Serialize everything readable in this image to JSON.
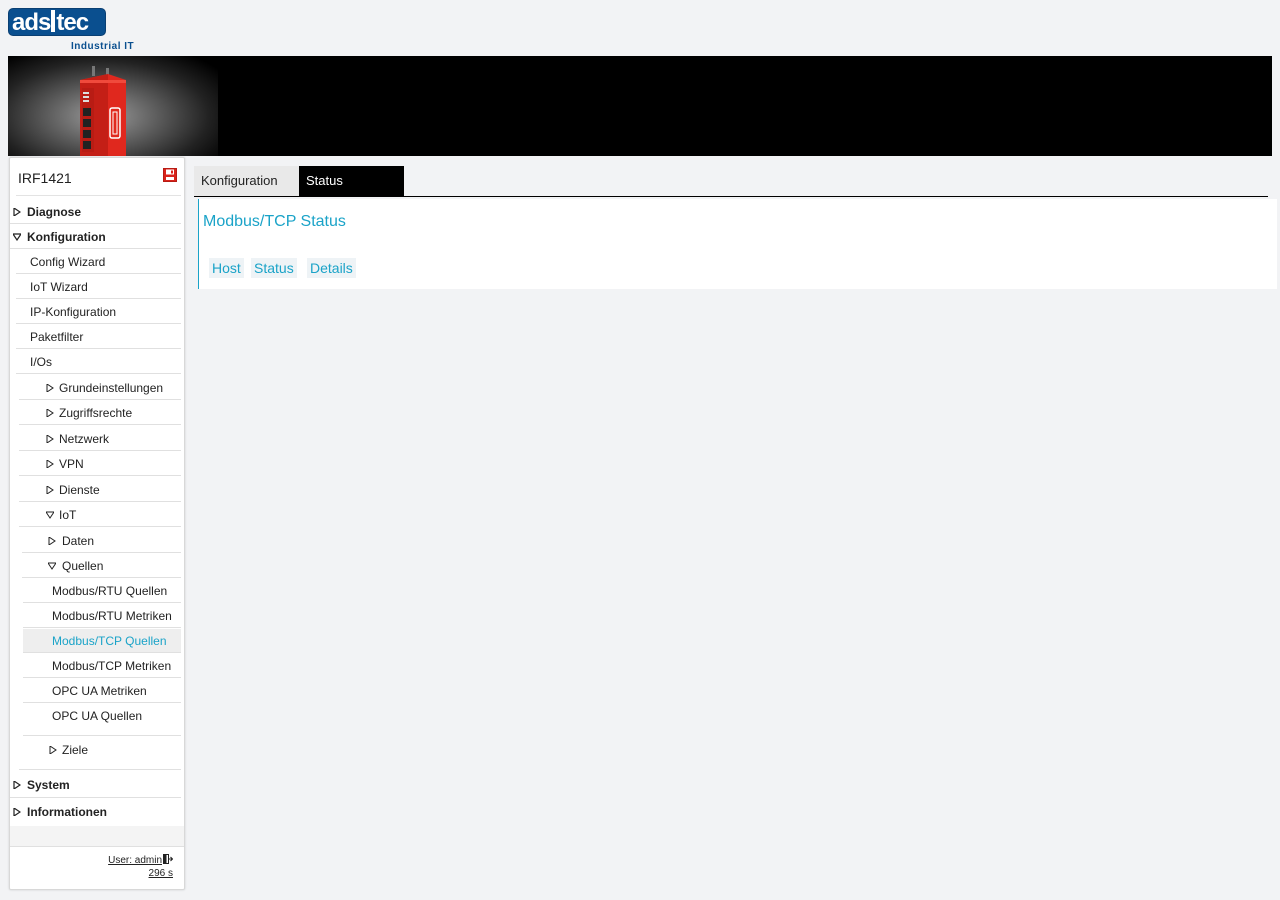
{
  "brand": {
    "logo_left": "ads",
    "logo_right": "tec",
    "subtitle": "Industrial IT"
  },
  "sidebar": {
    "device_name": "IRF1421",
    "items": [
      {
        "label": "Diagnose"
      },
      {
        "label": "Konfiguration"
      },
      {
        "label": "Config Wizard"
      },
      {
        "label": "IoT Wizard"
      },
      {
        "label": "IP-Konfiguration"
      },
      {
        "label": "Paketfilter"
      },
      {
        "label": "I/Os"
      },
      {
        "label": "Grundeinstellungen"
      },
      {
        "label": "Zugriffsrechte"
      },
      {
        "label": "Netzwerk"
      },
      {
        "label": "VPN"
      },
      {
        "label": "Dienste"
      },
      {
        "label": "IoT"
      },
      {
        "label": "Daten"
      },
      {
        "label": "Quellen"
      },
      {
        "label": "Modbus/RTU Quellen"
      },
      {
        "label": "Modbus/RTU Metriken"
      },
      {
        "label": "Modbus/TCP Quellen"
      },
      {
        "label": "Modbus/TCP Metriken"
      },
      {
        "label": "OPC UA Metriken"
      },
      {
        "label": "OPC UA Quellen"
      },
      {
        "label": "Ziele"
      },
      {
        "label": "System"
      },
      {
        "label": "Informationen"
      }
    ],
    "user_label": "User: admin",
    "session_timer": "296 s"
  },
  "tabs": [
    {
      "label": "Konfiguration",
      "active": false
    },
    {
      "label": "Status",
      "active": true
    }
  ],
  "main": {
    "title": "Modbus/TCP Status",
    "columns": [
      "Host",
      "Status",
      "Details"
    ]
  },
  "colors": {
    "accent": "#1aa3c8",
    "brand": "#0a4f8f",
    "device_red": "#e0281e"
  }
}
